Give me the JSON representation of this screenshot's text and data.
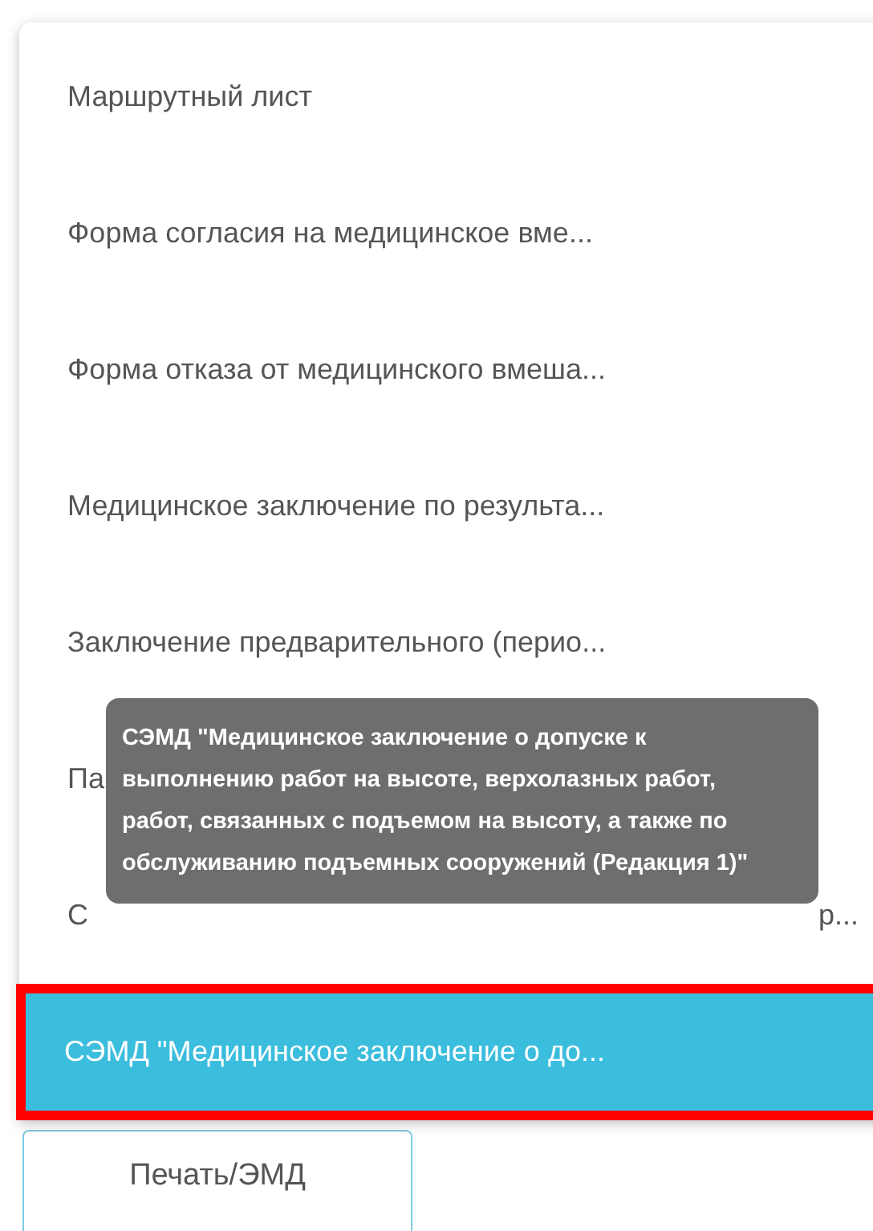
{
  "menu": {
    "items": [
      {
        "label": "Маршрутный лист",
        "selected": false
      },
      {
        "label": "Форма согласия на медицинское вме...",
        "selected": false
      },
      {
        "label": "Форма отказа от медицинского вмеша...",
        "selected": false
      },
      {
        "label": "Медицинское заключение по результа...",
        "selected": false
      },
      {
        "label": "Заключение предварительного (перио...",
        "selected": false
      },
      {
        "label": "Па",
        "selected": false
      },
      {
        "label": "С",
        "label_end": "р...",
        "selected": false
      },
      {
        "label": "СЭМД \"Медицинское заключение о до...",
        "selected": true
      }
    ]
  },
  "tooltip": {
    "text": "СЭМД \"Медицинское заключение о допуске к выполнению работ на высоте, верхолазных работ, работ, связанных с подъемом на высоту, а также по обслуживанию подъемных сооружений (Редакция 1)\""
  },
  "button": {
    "label": "Печать/ЭМД"
  }
}
